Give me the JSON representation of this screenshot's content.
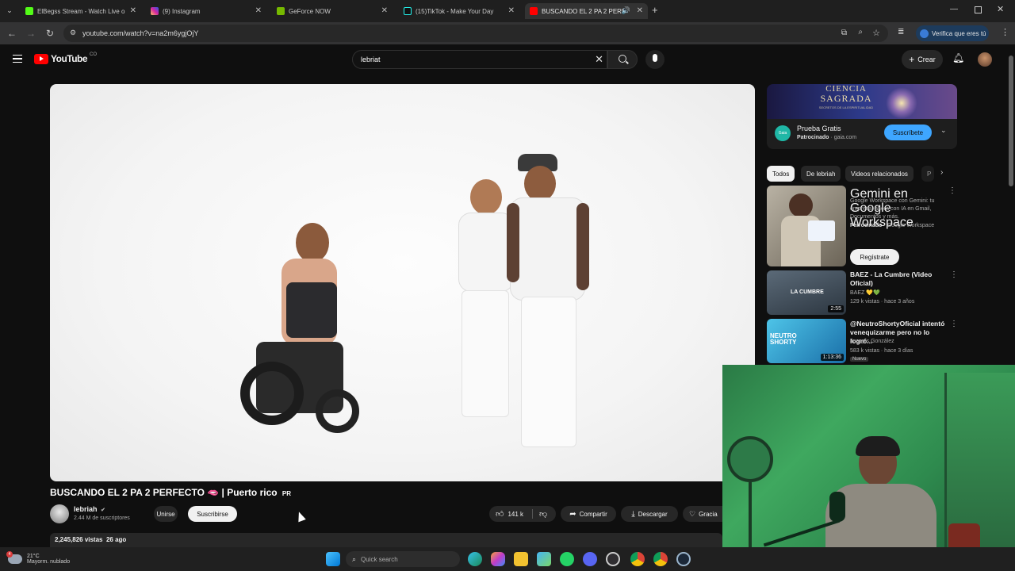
{
  "browser": {
    "tabs": [
      {
        "title": "ElBegss Stream - Watch Live o",
        "favicon_color": "#53fc18"
      },
      {
        "title": "(9) Instagram",
        "favicon_color": "#d6249f"
      },
      {
        "title": "GeForce NOW",
        "favicon_color": "#76b900"
      },
      {
        "title": "(15)TikTok - Make Your Day",
        "favicon_color": "#111111"
      },
      {
        "title": "BUSCANDO EL 2 PA 2 PERF",
        "favicon_color": "#ff0000"
      }
    ],
    "url": "youtube.com/watch?v=na2m6ygjOjY",
    "verify_label": "Verifica que eres tú"
  },
  "youtube": {
    "logo_text": "YouTube",
    "country": "CO",
    "search_value": "lebriat",
    "create_label": "Crear"
  },
  "video": {
    "title": "BUSCANDO EL 2 PA 2 PERFECTO 🫦 | Puerto rico",
    "title_badge": "PR",
    "channel": "lebriah",
    "subscribers": "2.44 M de suscriptores",
    "join_label": "Unirse",
    "subscribe_label": "Suscribirse",
    "likes": "141 k",
    "share_label": "Compartir",
    "download_label": "Descargar",
    "thanks_label": "Gracia",
    "views_date": "2,245,826 vistas  26 ago"
  },
  "ad": {
    "banner_line1": "CIENCIA",
    "banner_line2": "SAGRADA",
    "banner_line3": "SECRETOS DE LA ESPIRITUALIDAD",
    "brand_initial": "Gaia",
    "title": "Prueba Gratis",
    "sponsored": "Patrocinado",
    "domain": "gaia.com",
    "cta": "Suscríbete"
  },
  "chips": [
    "Todos",
    "De lebriah",
    "Videos relacionados",
    "P"
  ],
  "recommendations": [
    {
      "title": "Gemini en Google Workspace",
      "desc": "Google Workspace con Gemini: tu empresa, ahora con IA en Gmail, Documentos y más.",
      "sponsored": "Patrocinado",
      "channel": "Google Workspace",
      "cta": "Regístrate"
    },
    {
      "title": "BAEZ - La Cumbre (Video Oficial)",
      "channel": "BAEZ 💛💚",
      "meta": "129 k vistas · hace 3 años",
      "duration": "2:55",
      "thumb_text": "LA CUMBRE"
    },
    {
      "title": "@NeutroShortyOficial intentó venequizarme pero no lo logró...",
      "channel": "Juanpis González",
      "meta": "583 k vistas · hace 3 días",
      "badge": "Nuevo",
      "duration": "1:13:36",
      "thumb_text": "NEUTRO SHORTY"
    }
  ],
  "taskbar": {
    "temp": "21°C",
    "weather": "Mayorm. nublado",
    "search_placeholder": "Quick search"
  },
  "colors": {
    "yt_red": "#ff0000",
    "accent_blue": "#3ea6ff",
    "webcam_green": "#3fa85f"
  }
}
